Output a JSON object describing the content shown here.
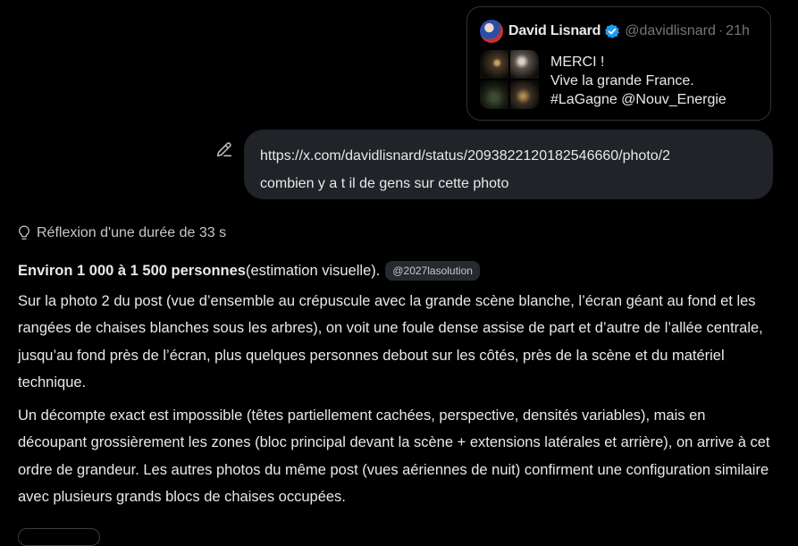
{
  "quoted_tweet": {
    "author_name": "David Lisnard",
    "handle": "@davidlisnard",
    "separator": "·",
    "time": "21h",
    "text_lines": [
      "MERCI !",
      "Vive la grande France.",
      "#LaGagne @Nouv_Energie"
    ],
    "verified_color": "#1d9bf0"
  },
  "user_message": {
    "lines": [
      "https://x.com/davidlisnard/status/2093822120182546660/photo/2",
      "combien y a t il de gens sur cette photo"
    ]
  },
  "reasoning": {
    "label": "Réflexion d'une durée de 33 s"
  },
  "answer": {
    "headline_bold": "Environ 1 000 à 1 500 personnes",
    "headline_rest": " (estimation visuelle).",
    "source_chip": "@2027lasolution",
    "paragraphs": [
      "Sur la photo 2 du post (vue d’ensemble au crépuscule avec la grande scène blanche, l’écran géant au fond et les rangées de chaises blanches sous les arbres), on voit une foule dense assise de part et d’autre de l’allée centrale, jusqu’au fond près de l’écran, plus quelques personnes debout sur les côtés, près de la scène et du matériel technique.",
      "Un décompte exact est impossible (têtes partiellement cachées, perspective, densités variables), mais en découpant grossièrement les zones (bloc principal devant la scène + extensions latérales et arrière), on arrive à cet ordre de grandeur. Les autres photos du même post (vues aériennes de nuit) confirment une configuration similaire avec plusieurs grands blocs de chaises occupées."
    ]
  },
  "colors": {
    "background": "#000000",
    "bubble": "#202327",
    "text": "#e7e9ea",
    "muted": "#71767b"
  }
}
